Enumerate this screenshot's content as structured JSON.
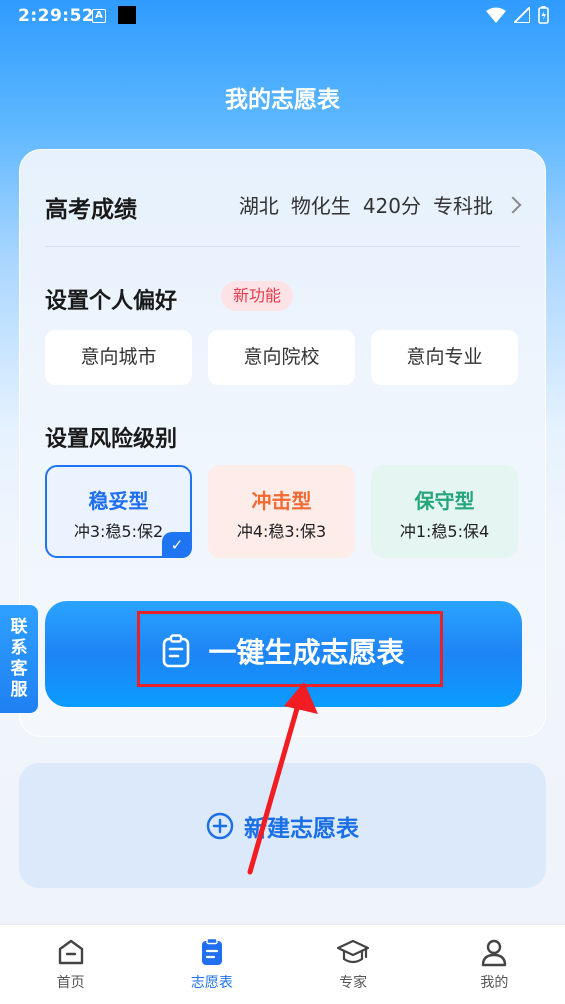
{
  "status_bar": {
    "time": "2:29:52",
    "a_icon": "A"
  },
  "title": "我的志愿表",
  "score": {
    "label": "高考成绩",
    "province": "湖北",
    "subjects": "物化生",
    "points": "420分",
    "batch": "专科批"
  },
  "preference": {
    "title": "设置个人偏好",
    "badge": "新功能",
    "options": [
      "意向城市",
      "意向院校",
      "意向专业"
    ]
  },
  "risk": {
    "title": "设置风险级别",
    "levels": [
      {
        "name": "稳妥型",
        "ratio": "冲3:稳5:保2",
        "selected": true,
        "color": "#1f6ff0"
      },
      {
        "name": "冲击型",
        "ratio": "冲4:稳3:保3",
        "selected": false,
        "color": "#f26a33"
      },
      {
        "name": "保守型",
        "ratio": "冲1:稳5:保4",
        "selected": false,
        "color": "#25a67a"
      }
    ]
  },
  "generate_button": "一键生成志愿表",
  "side_tab": [
    "联",
    "系",
    "客",
    "服"
  ],
  "new_table_button": "新建志愿表",
  "nav": [
    {
      "label": "首页",
      "icon": "home-icon",
      "active": false
    },
    {
      "label": "志愿表",
      "icon": "clipboard-icon",
      "active": true
    },
    {
      "label": "专家",
      "icon": "graduation-cap-icon",
      "active": false
    },
    {
      "label": "我的",
      "icon": "user-icon",
      "active": false
    }
  ],
  "colors": {
    "accent": "#1f6ff0",
    "highlight": "#e8222b"
  }
}
